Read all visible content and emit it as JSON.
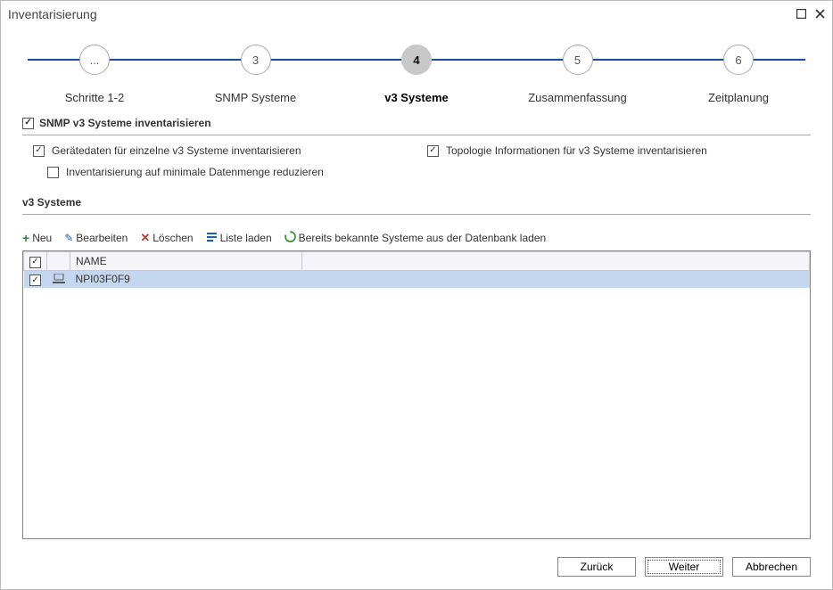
{
  "window": {
    "title": "Inventarisierung"
  },
  "stepper": {
    "steps": [
      {
        "num": "...",
        "label": "Schritte 1-2",
        "active": false
      },
      {
        "num": "3",
        "label": "SNMP Systeme",
        "active": false
      },
      {
        "num": "4",
        "label": "v3 Systeme",
        "active": true
      },
      {
        "num": "5",
        "label": "Zusammenfassung",
        "active": false
      },
      {
        "num": "6",
        "label": "Zeitplanung",
        "active": false
      }
    ]
  },
  "section": {
    "main_checkbox_label": "SNMP v3 Systeme inventarisieren",
    "device_data_label": "Gerätedaten für einzelne v3 Systeme inventarisieren",
    "topology_label": "Topologie Informationen für v3 Systeme inventarisieren",
    "minimal_label": "Inventarisierung auf minimale Datenmenge reduzieren",
    "subheader": "v3 Systeme"
  },
  "toolbar": {
    "add": "Neu",
    "edit": "Bearbeiten",
    "delete": "Löschen",
    "load_list": "Liste laden",
    "load_known": "Bereits bekannte Systeme aus der Datenbank laden"
  },
  "grid": {
    "col_name": "NAME",
    "rows": [
      {
        "checked": true,
        "name": "NPI03F0F9"
      }
    ]
  },
  "footer": {
    "back": "Zurück",
    "next": "Weiter",
    "cancel": "Abbrechen"
  }
}
